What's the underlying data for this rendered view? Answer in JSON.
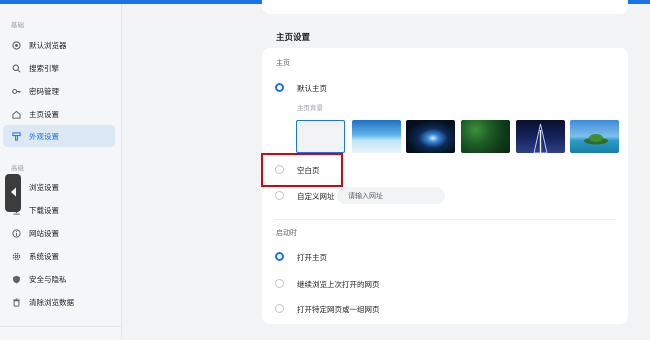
{
  "sidebar": {
    "group_basic": "基础",
    "group_advanced": "高级",
    "items": [
      {
        "label": "默认浏览器",
        "icon": "browser-icon"
      },
      {
        "label": "搜索引擎",
        "icon": "search-icon"
      },
      {
        "label": "密码管理",
        "icon": "key-icon"
      },
      {
        "label": "主页设置",
        "icon": "home-icon"
      },
      {
        "label": "外观设置",
        "icon": "palette-icon",
        "active": true
      },
      {
        "label": "浏览设置",
        "icon": "browse-icon"
      },
      {
        "label": "下载设置",
        "icon": "download-icon"
      },
      {
        "label": "网站设置",
        "icon": "info-icon"
      },
      {
        "label": "系统设置",
        "icon": "gear-icon"
      },
      {
        "label": "安全与隐私",
        "icon": "shield-icon"
      },
      {
        "label": "清除浏览数据",
        "icon": "trash-icon"
      }
    ]
  },
  "homepage": {
    "section_title": "主页设置",
    "group_label": "主页",
    "default_option": "默认主页",
    "background_label": "主页背景",
    "blank_option": "空白页",
    "custom_option": "自定义网址",
    "url_placeholder": "请输入网址",
    "selected": "默认主页"
  },
  "startup": {
    "group_label": "启动时",
    "options": [
      "打开主页",
      "继续浏览上次打开的网页",
      "打开特定网页或一组网页"
    ],
    "selected": "打开主页"
  },
  "colors": {
    "accent": "#1a73e8",
    "highlight_box": "#e0000a"
  }
}
